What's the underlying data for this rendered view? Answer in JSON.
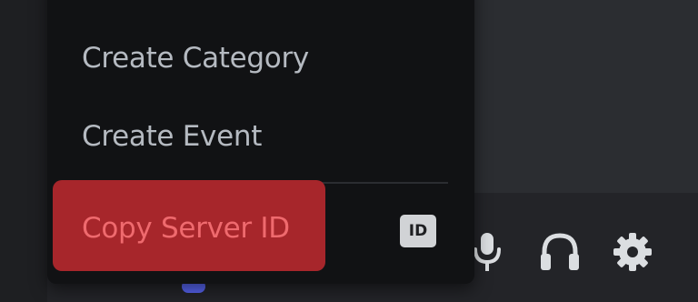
{
  "context_menu": {
    "items": [
      {
        "label": "Create Category"
      },
      {
        "label": "Create Event"
      }
    ],
    "copy_server_id": {
      "label": "Copy Server ID",
      "badge": "ID",
      "highlight_color": "#a7262b",
      "text_color": "#ef6a6e"
    }
  },
  "user_controls": {
    "icons": [
      "microphone-icon",
      "headset-icon",
      "settings-gear-icon"
    ]
  },
  "colors": {
    "menu_background": "#111214",
    "app_background": "#2b2d31",
    "menu_text": "#b5bac1"
  }
}
